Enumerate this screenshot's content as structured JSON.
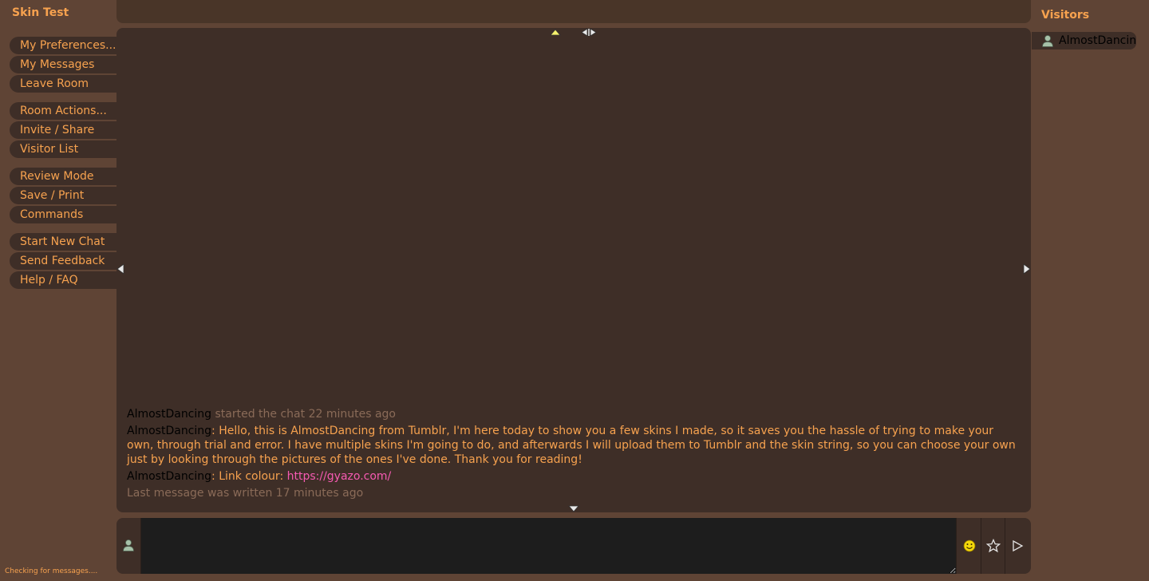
{
  "room": {
    "title": "Skin Test"
  },
  "menu": {
    "groups": [
      [
        "My Preferences...",
        "My Messages",
        "Leave Room"
      ],
      [
        "Room Actions...",
        "Invite / Share",
        "Visitor List"
      ],
      [
        "Review Mode",
        "Save / Print",
        "Commands"
      ],
      [
        "Start New Chat",
        "Send Feedback",
        "Help / FAQ"
      ]
    ]
  },
  "chat": {
    "messages": [
      {
        "nick": "AlmostDancing",
        "meta": " started the chat 22 minutes ago"
      },
      {
        "nick": "AlmostDancing",
        "sep": ": ",
        "text": "Hello, this is AlmostDancing from Tumblr, I'm here today to show you a few skins I made, so it saves you the hassle of trying to make your own, through trial and error. I have multiple skins I'm going to do, and afterwards I will upload them to Tumblr and the skin string, so you can choose your own just by looking through the pictures of the ones I've done. Thank you for reading!"
      },
      {
        "nick": "AlmostDancing",
        "sep": ": ",
        "text": "Link colour: ",
        "link": "https://gyazo.com/"
      }
    ],
    "last_message": "Last message was written 17 minutes ago"
  },
  "visitors": {
    "title": "Visitors",
    "list": [
      "AlmostDancing"
    ]
  },
  "status": "Checking for messages....",
  "icons": {
    "avatar": "user-icon",
    "smiley": "smiley-icon",
    "star": "star-icon",
    "send": "send-arrow-icon"
  },
  "colors": {
    "background": "#5f4435",
    "panel": "#3e2e27",
    "text": "#f7a24f",
    "link": "#f65ab2",
    "nick": "#000000",
    "meta": "#8a6b58"
  }
}
